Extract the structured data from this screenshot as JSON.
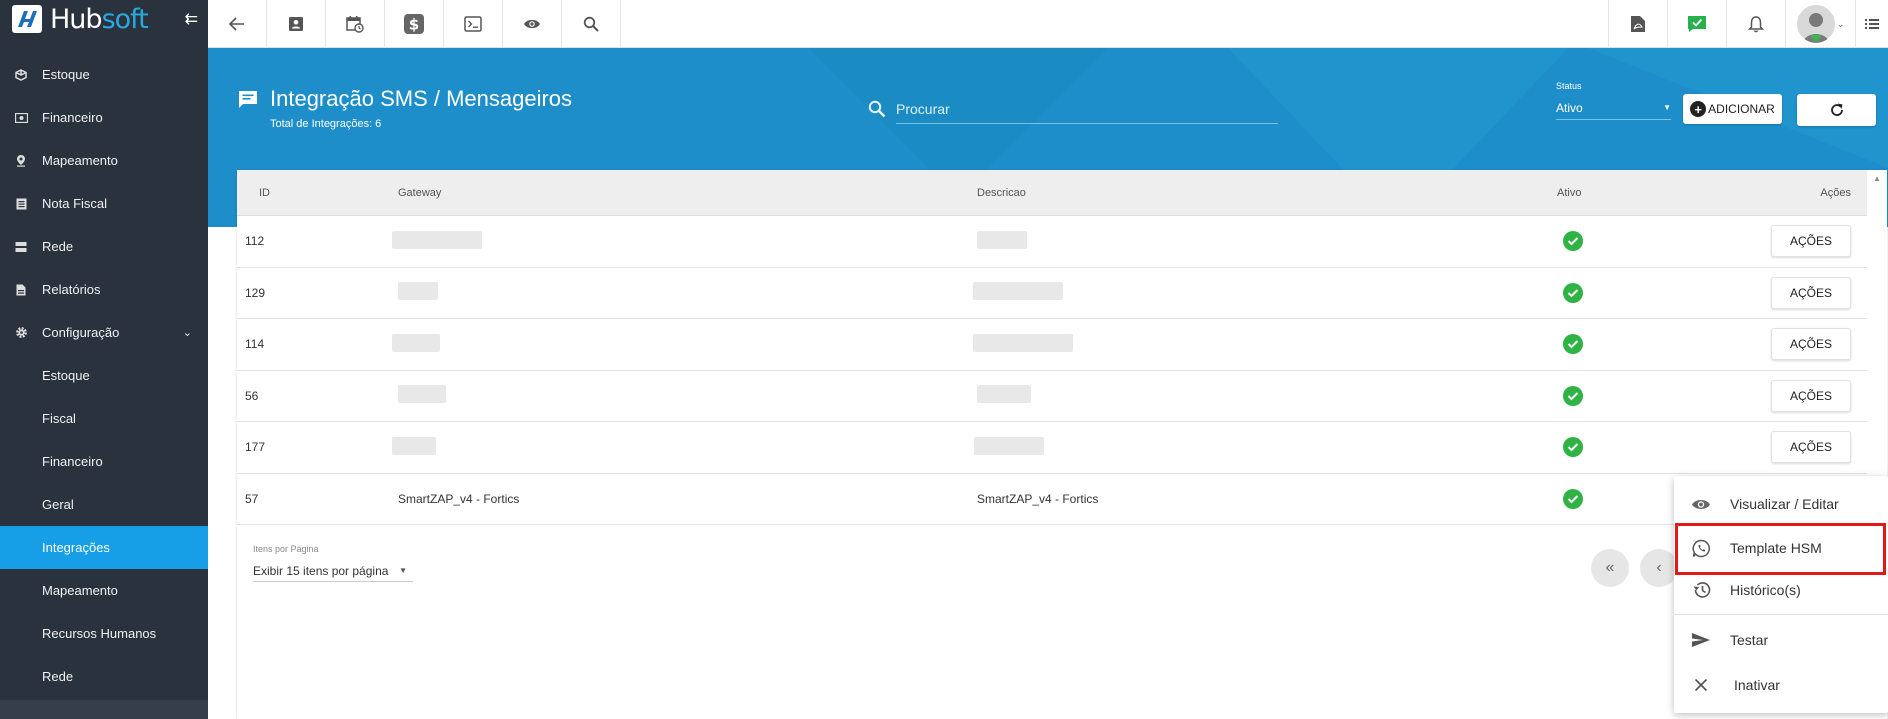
{
  "brand": {
    "part1": "Hub",
    "part2": "soft"
  },
  "sidebar": {
    "items": [
      {
        "label": "Estoque",
        "icon": "box-icon"
      },
      {
        "label": "Financeiro",
        "icon": "money-icon"
      },
      {
        "label": "Mapeamento",
        "icon": "map-pin-icon"
      },
      {
        "label": "Nota Fiscal",
        "icon": "receipt-icon"
      },
      {
        "label": "Rede",
        "icon": "server-icon"
      },
      {
        "label": "Relatórios",
        "icon": "file-icon"
      },
      {
        "label": "Configuração",
        "icon": "gear-icon"
      }
    ],
    "subitems": [
      {
        "label": "Estoque"
      },
      {
        "label": "Fiscal"
      },
      {
        "label": "Financeiro"
      },
      {
        "label": "Geral"
      },
      {
        "label": "Integrações",
        "active": true
      },
      {
        "label": "Mapeamento"
      },
      {
        "label": "Recursos Humanos"
      },
      {
        "label": "Rede"
      }
    ]
  },
  "header": {
    "title": "Integração SMS / Mensageiros",
    "subtitle": "Total de Integrações: 6",
    "search_placeholder": "Procurar",
    "status_label": "Status",
    "status_value": "Ativo",
    "add_label": "ADICIONAR"
  },
  "table": {
    "columns": {
      "id": "ID",
      "gateway": "Gateway",
      "descricao": "Descricao",
      "ativo": "Ativo",
      "acoes": "Ações"
    },
    "action_label": "AÇÕES",
    "rows": [
      {
        "id": "112",
        "gateway": "",
        "descricao": "",
        "has_action": true
      },
      {
        "id": "129",
        "gateway": "",
        "descricao": "",
        "has_action": true
      },
      {
        "id": "114",
        "gateway": "",
        "descricao": "",
        "has_action": true
      },
      {
        "id": "56",
        "gateway": "",
        "descricao": "",
        "has_action": true
      },
      {
        "id": "177",
        "gateway": "",
        "descricao": "",
        "has_action": true
      },
      {
        "id": "57",
        "gateway": "SmartZAP_v4 - Fortics",
        "descricao": "SmartZAP_v4 - Fortics",
        "has_action": false
      }
    ]
  },
  "pagination": {
    "per_page_label": "Itens por Página",
    "per_page_value": "Exibir 15 itens por página"
  },
  "menu": {
    "items": [
      {
        "label": "Visualizar / Editar",
        "icon": "eye-icon"
      },
      {
        "label": "Template HSM",
        "icon": "whatsapp-icon"
      },
      {
        "label": "Histórico(s)",
        "icon": "history-icon"
      },
      {
        "label": "Testar",
        "icon": "send-icon"
      },
      {
        "label": "Inativar",
        "icon": "close-icon"
      }
    ]
  },
  "colors": {
    "sidebar": "#2a323d",
    "accent": "#169fe6",
    "header": "#1d8ec9",
    "success": "#2fb344",
    "highlight": "#e01a1a"
  }
}
